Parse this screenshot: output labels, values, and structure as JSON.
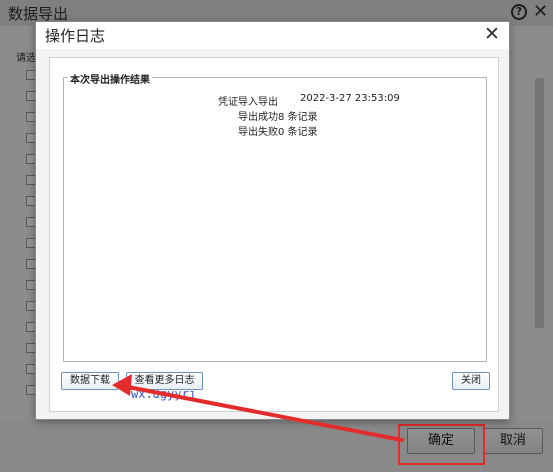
{
  "background_window": {
    "title": "数据导出",
    "prompt": "请选",
    "ok_label": "确定",
    "cancel_label": "取消",
    "icons": [
      "help-icon",
      "close-icon"
    ]
  },
  "dialog": {
    "title": "操作日志",
    "section_title": "本次导出操作结果",
    "log": {
      "line1_label": "凭证导入导出",
      "line1_time": "2022-3-27 23:53:09",
      "line2": "导出成功8 条记录",
      "line3": "导出失败0 条记录"
    },
    "buttons": {
      "download": "数据下载",
      "more_logs": "查看更多日志",
      "close": "关闭"
    }
  },
  "annotation": {
    "watermark": "wx:dgyyrj",
    "color": "#e32b2b"
  }
}
